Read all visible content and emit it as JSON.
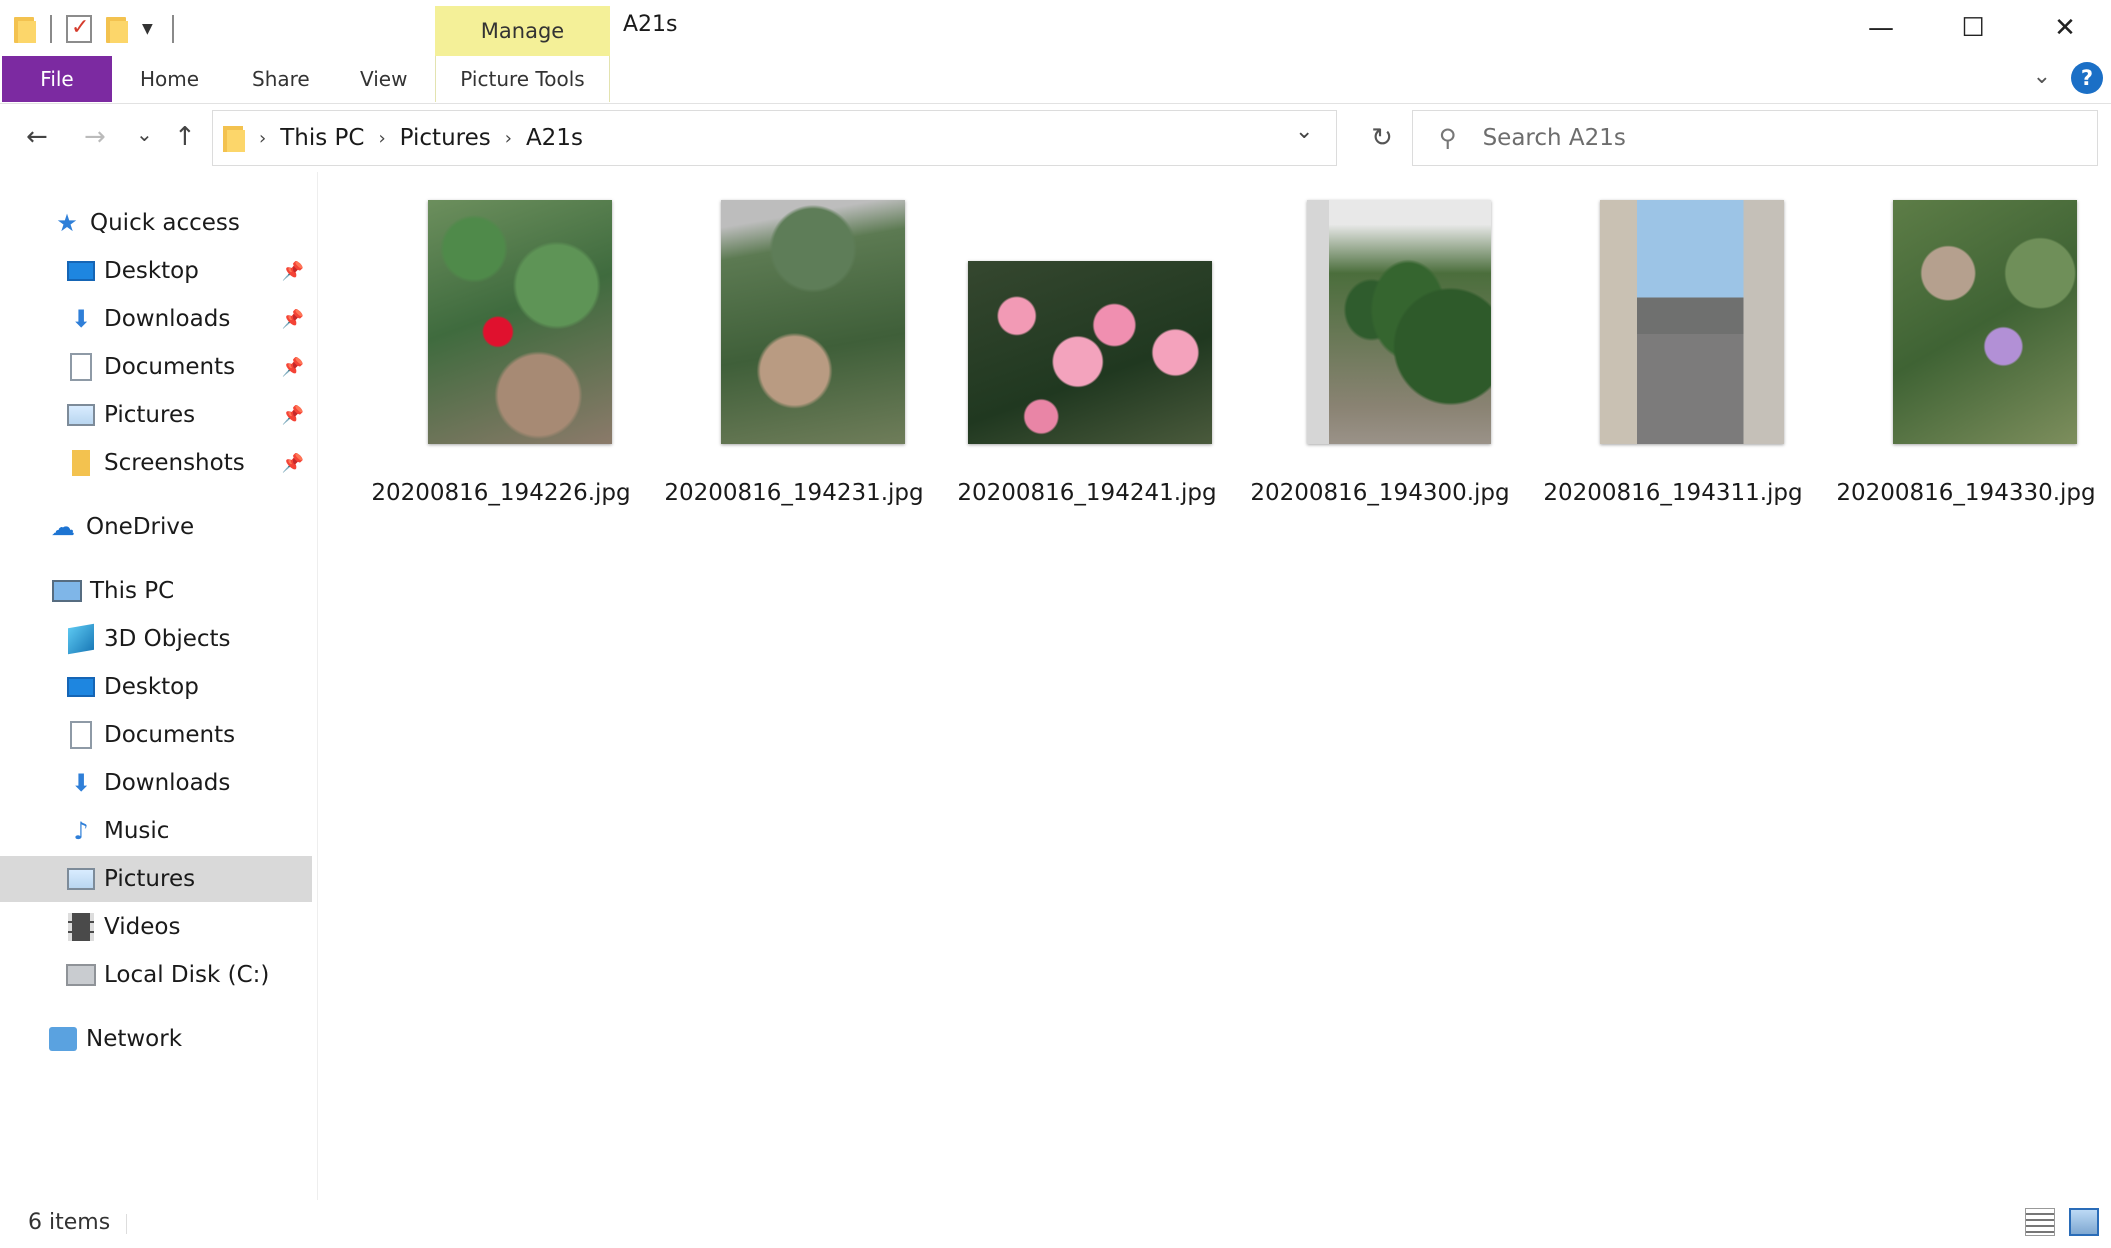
{
  "window": {
    "title": "A21s",
    "context_tab": "Manage",
    "controls": {
      "minimize": "—",
      "maximize": "☐",
      "close": "✕"
    }
  },
  "ribbon": {
    "tabs": [
      {
        "label": "File"
      },
      {
        "label": "Home"
      },
      {
        "label": "Share"
      },
      {
        "label": "View"
      },
      {
        "label": "Picture Tools"
      }
    ],
    "help_icon": "?"
  },
  "nav": {
    "back": "←",
    "forward": "→",
    "recent": "⌄",
    "up": "↑",
    "breadcrumb": [
      "This PC",
      "Pictures",
      "A21s"
    ],
    "crumb_sep": "›",
    "refresh": "↻",
    "search_placeholder": "Search A21s"
  },
  "sidebar": {
    "quick_access": {
      "label": "Quick access",
      "icon": "star-icon"
    },
    "quick_items": [
      {
        "label": "Desktop",
        "icon": "desktop-icon",
        "pinned": true
      },
      {
        "label": "Downloads",
        "icon": "downloads-icon",
        "pinned": true
      },
      {
        "label": "Documents",
        "icon": "documents-icon",
        "pinned": true
      },
      {
        "label": "Pictures",
        "icon": "pictures-icon",
        "pinned": true
      },
      {
        "label": "Screenshots",
        "icon": "folder-icon",
        "pinned": true
      }
    ],
    "onedrive": {
      "label": "OneDrive",
      "icon": "cloud-icon"
    },
    "this_pc": {
      "label": "This PC",
      "icon": "computer-icon"
    },
    "pc_items": [
      {
        "label": "3D Objects",
        "icon": "cube-icon"
      },
      {
        "label": "Desktop",
        "icon": "desktop-icon"
      },
      {
        "label": "Documents",
        "icon": "documents-icon"
      },
      {
        "label": "Downloads",
        "icon": "downloads-icon"
      },
      {
        "label": "Music",
        "icon": "music-icon"
      },
      {
        "label": "Pictures",
        "icon": "pictures-icon",
        "selected": true
      },
      {
        "label": "Videos",
        "icon": "videos-icon"
      },
      {
        "label": "Local Disk (C:)",
        "icon": "disk-icon"
      }
    ],
    "network": {
      "label": "Network",
      "icon": "network-icon"
    }
  },
  "files": [
    {
      "name": "20200816_194226.jpg",
      "subject": "red rose"
    },
    {
      "name": "20200816_194231.jpg",
      "subject": "garden shrubs"
    },
    {
      "name": "20200816_194241.jpg",
      "subject": "pink roses"
    },
    {
      "name": "20200816_194300.jpg",
      "subject": "cypress trees"
    },
    {
      "name": "20200816_194311.jpg",
      "subject": "street"
    },
    {
      "name": "20200816_194330.jpg",
      "subject": "purple flower"
    }
  ],
  "status": {
    "item_count": "6 items"
  },
  "colors": {
    "file_tab": "#7c2aa1",
    "manage_tab": "#f4f098",
    "selected_row": "#d9d9d9",
    "help": "#1b6fc6"
  }
}
